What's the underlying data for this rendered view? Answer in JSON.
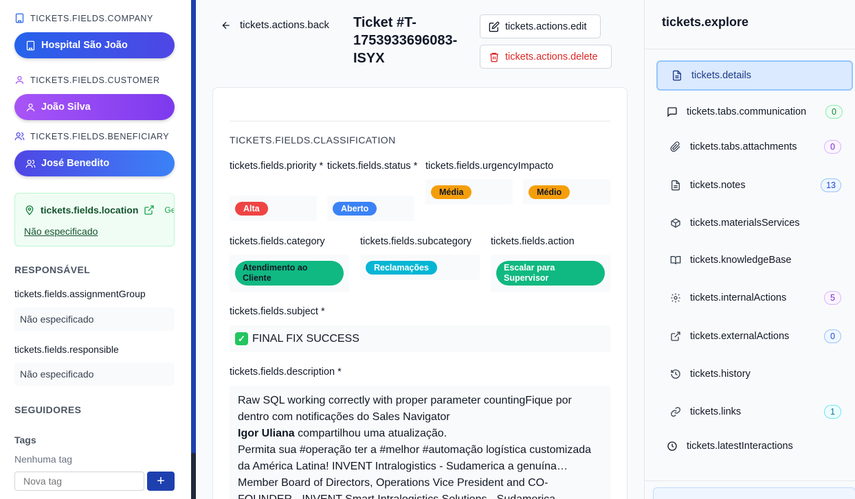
{
  "sidebar": {
    "company_label": "TICKETS.FIELDS.COMPANY",
    "company_value": "Hospital São João",
    "customer_label": "TICKETS.FIELDS.CUSTOMER",
    "customer_value": "João Silva",
    "beneficiary_label": "TICKETS.FIELDS.BENEFICIARY",
    "beneficiary_value": "José Benedito",
    "location_label": "tickets.fields.location",
    "location_manage": "Gerenc",
    "location_value": "Não especificado",
    "responsible_heading": "RESPONSÁVEL",
    "assignment_group_label": "tickets.fields.assignmentGroup",
    "assignment_group_value": "Não especificado",
    "responsible_label": "tickets.fields.responsible",
    "responsible_value": "Não especificado",
    "followers_heading": "SEGUIDORES",
    "tags_label": "Tags",
    "tags_empty": "Nenhuma tag",
    "tag_placeholder": "Nova tag",
    "tag_add": "+"
  },
  "header": {
    "back_label": "tickets.actions.back",
    "ticket_title": "Ticket #T-1753933696083-ISYX",
    "edit_label": "tickets.actions.edit",
    "delete_label": "tickets.actions.delete"
  },
  "classification": {
    "title": "TICKETS.FIELDS.CLASSIFICATION",
    "priority_label": "tickets.fields.priority *",
    "priority_value": "Alta",
    "status_label": "tickets.fields.status *",
    "status_value": "Aberto",
    "urgency_label": "tickets.fields.urgencyImpacto",
    "urgency_value": "Média",
    "impact_value": "Médio",
    "category_label": "tickets.fields.category",
    "category_value": "Atendimento ao Cliente",
    "subcategory_label": "tickets.fields.subcategory",
    "subcategory_value": "Reclamações",
    "action_label": "tickets.fields.action",
    "action_value": "Escalar para Supervisor",
    "subject_label": "tickets.fields.subject *",
    "subject_value": "FINAL FIX SUCCESS",
    "description_label": "tickets.fields.description *",
    "description_line1": "Raw SQL working correctly with proper parameter countingFique por dentro com notificações do Sales Navigator",
    "description_author": "Igor Uliana",
    "description_line2": " compartilhou uma atualização.",
    "description_line3": "Permita sua #operação ter a #melhor #automação logística customizada da América Latina! INVENT Intralogistics - Sudamerica a genuína…",
    "description_line4": "Member Board of Directors, Operations Vice President and CO-FOUNDER - INVENT Smart Intralogistics Solutions - Sudamerica"
  },
  "explore": {
    "title": "tickets.explore",
    "items": [
      {
        "label": "tickets.details",
        "count": ""
      },
      {
        "label": "tickets.tabs.communication",
        "count": "0"
      },
      {
        "label": "tickets.tabs.attachments",
        "count": "0"
      },
      {
        "label": "tickets.notes",
        "count": "13"
      },
      {
        "label": "tickets.materialsServices",
        "count": ""
      },
      {
        "label": "tickets.knowledgeBase",
        "count": ""
      },
      {
        "label": "tickets.internalActions",
        "count": "5"
      },
      {
        "label": "tickets.externalActions",
        "count": "0"
      },
      {
        "label": "tickets.history",
        "count": ""
      },
      {
        "label": "tickets.links",
        "count": "1"
      },
      {
        "label": "tickets.latestInteractions",
        "count": ""
      }
    ]
  },
  "colors": {
    "company_gradient": [
      "#2563eb",
      "#4f46e5"
    ],
    "customer_gradient": [
      "#a855f7",
      "#7c3aed"
    ],
    "beneficiary_gradient": [
      "#4f46e5",
      "#3b82f6"
    ],
    "priority_red": "#ef4444",
    "status_blue": "#3b82f6",
    "urgency_orange": "#f59e0b",
    "category_green": "#10b981",
    "subcategory_cyan": "#06b6d4",
    "delete_red": "#dc2626"
  }
}
